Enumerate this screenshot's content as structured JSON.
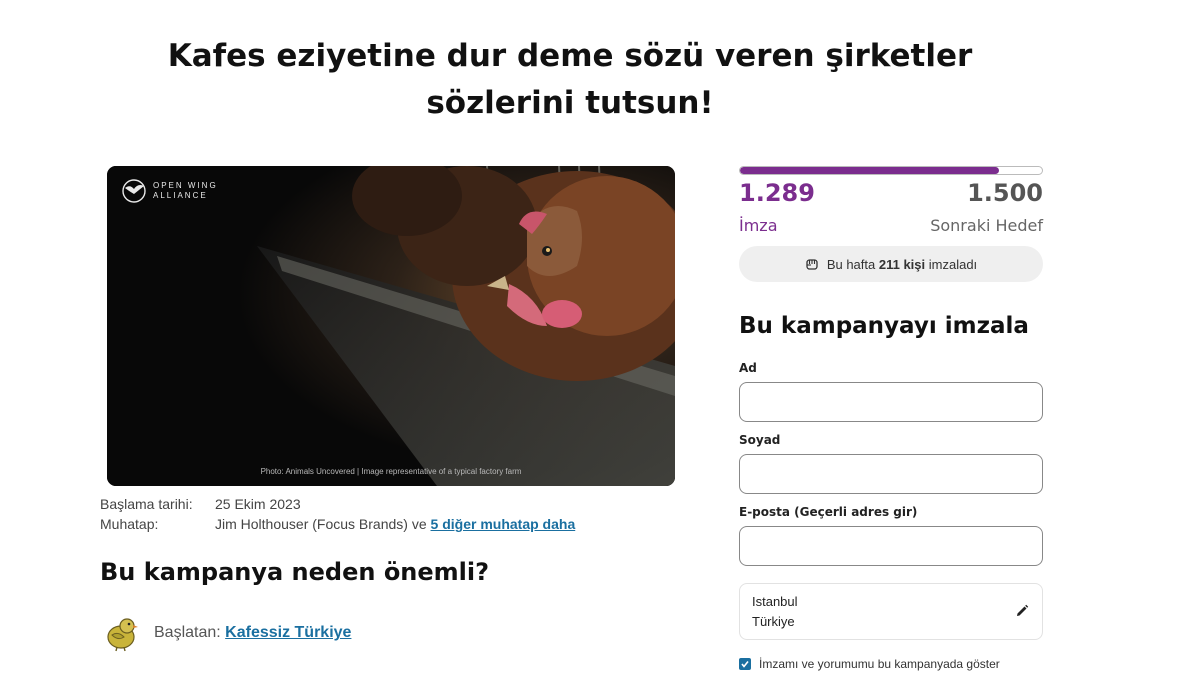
{
  "page": {
    "title": "Kafes eziyetine dur deme sözü veren şirketler sözlerini tutsun!"
  },
  "hero": {
    "brand_line1": "OPEN WING",
    "brand_line2": "ALLIANCE",
    "photo_credit": "Photo: Animals Uncovered | Image representative of a typical factory farm"
  },
  "meta": {
    "start_label": "Başlama tarihi:",
    "start_value": "25 Ekim 2023",
    "target_label": "Muhatap:",
    "target_value": "Jim Holthouser (Focus Brands) ve ",
    "target_link": "5 diğer muhatap daha"
  },
  "why_heading": "Bu kampanya neden önemli?",
  "starter": {
    "prefix": "Başlatan: ",
    "name": "Kafessiz Türkiye"
  },
  "progress": {
    "signatures": "1.289",
    "signatures_label": "İmza",
    "goal": "1.500",
    "goal_label": "Sonraki Hedef",
    "fraction": 0.859,
    "accent_color": "#7b2d8e"
  },
  "weekly": {
    "prefix": "Bu hafta ",
    "count": "211 kişi",
    "suffix": " imzaladı",
    "icon": "raised-fist-icon"
  },
  "form": {
    "heading": "Bu kampanyayı imzala",
    "first_name_label": "Ad",
    "first_name_value": "",
    "last_name_label": "Soyad",
    "last_name_value": "",
    "email_label": "E-posta (Geçerli adres gir)",
    "email_value": "",
    "city": "Istanbul",
    "country": "Türkiye",
    "consent_label": "İmzamı ve yorumumu bu kampanyada göster",
    "consent_checked": true
  },
  "colors": {
    "link": "#1a6fa0",
    "accent": "#7b2d8e"
  }
}
